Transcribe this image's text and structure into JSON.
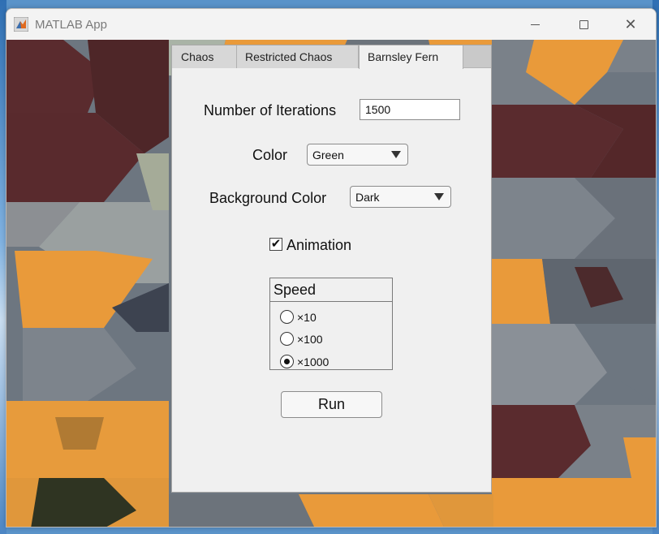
{
  "window": {
    "title": "MATLAB App",
    "controls": {
      "minimize": "minimize-icon",
      "maximize": "maximize-icon",
      "close": "close-icon"
    }
  },
  "tabs": [
    {
      "label": "Chaos",
      "selected": false
    },
    {
      "label": "Restricted Chaos",
      "selected": false
    },
    {
      "label": "Barnsley Fern",
      "selected": true
    }
  ],
  "form": {
    "iterations_label": "Number of Iterations",
    "iterations_value": "1500",
    "color_label": "Color",
    "color_value": "Green",
    "bg_color_label": "Background Color",
    "bg_color_value": "Dark",
    "animation_label": "Animation",
    "animation_checked": true,
    "speed_title": "Speed",
    "speed_options": [
      {
        "label": "×10",
        "selected": false
      },
      {
        "label": "×100",
        "selected": false
      },
      {
        "label": "×1000",
        "selected": true
      }
    ],
    "run_label": "Run"
  },
  "colors": {
    "tile_orange": "#e99a3a",
    "tile_maroon": "#5a2b2e",
    "tile_slate": "#6d7680",
    "tile_sage": "#a9b3a6"
  }
}
